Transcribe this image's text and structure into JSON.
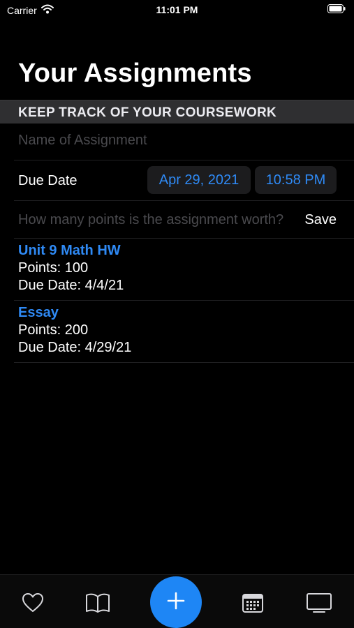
{
  "status_bar": {
    "carrier": "Carrier",
    "time": "11:01 PM"
  },
  "header": {
    "title": "Your Assignments",
    "section_header": "KEEP TRACK OF YOUR COURSEWORK"
  },
  "form": {
    "name_placeholder": "Name of Assignment",
    "name_value": "",
    "due_label": "Due Date",
    "date_value": "Apr 29, 2021",
    "time_value": "10:58 PM",
    "points_placeholder": "How many points is the assignment worth?",
    "points_value": "",
    "save_label": "Save"
  },
  "assignments": [
    {
      "title": "Unit 9 Math HW",
      "points": "Points: 100",
      "due": "Due Date: 4/4/21"
    },
    {
      "title": "Essay",
      "points": "Points: 200",
      "due": "Due Date: 4/29/21"
    }
  ],
  "tab_bar": {
    "items": [
      "heart-icon",
      "book-icon",
      "plus-icon",
      "calendar-icon",
      "tv-icon"
    ]
  },
  "colors": {
    "accent": "#2f8af5",
    "add_button": "#1e86f5",
    "background": "#000000",
    "section_header_bg": "#2f2f31",
    "pill_bg": "#1c1c1e"
  }
}
